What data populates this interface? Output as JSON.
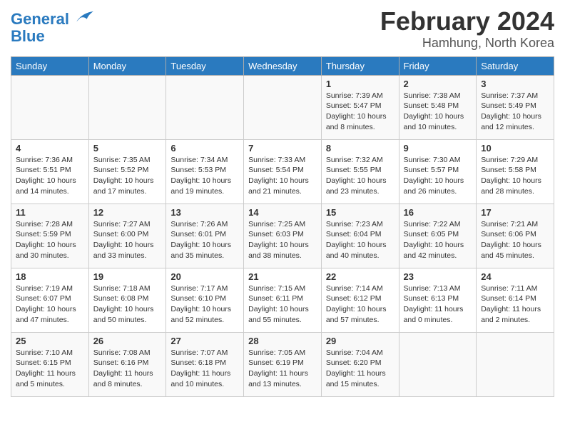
{
  "header": {
    "logo_line1": "General",
    "logo_line2": "Blue",
    "month": "February 2024",
    "location": "Hamhung, North Korea"
  },
  "weekdays": [
    "Sunday",
    "Monday",
    "Tuesday",
    "Wednesday",
    "Thursday",
    "Friday",
    "Saturday"
  ],
  "weeks": [
    [
      {
        "day": "",
        "info": ""
      },
      {
        "day": "",
        "info": ""
      },
      {
        "day": "",
        "info": ""
      },
      {
        "day": "",
        "info": ""
      },
      {
        "day": "1",
        "info": "Sunrise: 7:39 AM\nSunset: 5:47 PM\nDaylight: 10 hours\nand 8 minutes."
      },
      {
        "day": "2",
        "info": "Sunrise: 7:38 AM\nSunset: 5:48 PM\nDaylight: 10 hours\nand 10 minutes."
      },
      {
        "day": "3",
        "info": "Sunrise: 7:37 AM\nSunset: 5:49 PM\nDaylight: 10 hours\nand 12 minutes."
      }
    ],
    [
      {
        "day": "4",
        "info": "Sunrise: 7:36 AM\nSunset: 5:51 PM\nDaylight: 10 hours\nand 14 minutes."
      },
      {
        "day": "5",
        "info": "Sunrise: 7:35 AM\nSunset: 5:52 PM\nDaylight: 10 hours\nand 17 minutes."
      },
      {
        "day": "6",
        "info": "Sunrise: 7:34 AM\nSunset: 5:53 PM\nDaylight: 10 hours\nand 19 minutes."
      },
      {
        "day": "7",
        "info": "Sunrise: 7:33 AM\nSunset: 5:54 PM\nDaylight: 10 hours\nand 21 minutes."
      },
      {
        "day": "8",
        "info": "Sunrise: 7:32 AM\nSunset: 5:55 PM\nDaylight: 10 hours\nand 23 minutes."
      },
      {
        "day": "9",
        "info": "Sunrise: 7:30 AM\nSunset: 5:57 PM\nDaylight: 10 hours\nand 26 minutes."
      },
      {
        "day": "10",
        "info": "Sunrise: 7:29 AM\nSunset: 5:58 PM\nDaylight: 10 hours\nand 28 minutes."
      }
    ],
    [
      {
        "day": "11",
        "info": "Sunrise: 7:28 AM\nSunset: 5:59 PM\nDaylight: 10 hours\nand 30 minutes."
      },
      {
        "day": "12",
        "info": "Sunrise: 7:27 AM\nSunset: 6:00 PM\nDaylight: 10 hours\nand 33 minutes."
      },
      {
        "day": "13",
        "info": "Sunrise: 7:26 AM\nSunset: 6:01 PM\nDaylight: 10 hours\nand 35 minutes."
      },
      {
        "day": "14",
        "info": "Sunrise: 7:25 AM\nSunset: 6:03 PM\nDaylight: 10 hours\nand 38 minutes."
      },
      {
        "day": "15",
        "info": "Sunrise: 7:23 AM\nSunset: 6:04 PM\nDaylight: 10 hours\nand 40 minutes."
      },
      {
        "day": "16",
        "info": "Sunrise: 7:22 AM\nSunset: 6:05 PM\nDaylight: 10 hours\nand 42 minutes."
      },
      {
        "day": "17",
        "info": "Sunrise: 7:21 AM\nSunset: 6:06 PM\nDaylight: 10 hours\nand 45 minutes."
      }
    ],
    [
      {
        "day": "18",
        "info": "Sunrise: 7:19 AM\nSunset: 6:07 PM\nDaylight: 10 hours\nand 47 minutes."
      },
      {
        "day": "19",
        "info": "Sunrise: 7:18 AM\nSunset: 6:08 PM\nDaylight: 10 hours\nand 50 minutes."
      },
      {
        "day": "20",
        "info": "Sunrise: 7:17 AM\nSunset: 6:10 PM\nDaylight: 10 hours\nand 52 minutes."
      },
      {
        "day": "21",
        "info": "Sunrise: 7:15 AM\nSunset: 6:11 PM\nDaylight: 10 hours\nand 55 minutes."
      },
      {
        "day": "22",
        "info": "Sunrise: 7:14 AM\nSunset: 6:12 PM\nDaylight: 10 hours\nand 57 minutes."
      },
      {
        "day": "23",
        "info": "Sunrise: 7:13 AM\nSunset: 6:13 PM\nDaylight: 11 hours\nand 0 minutes."
      },
      {
        "day": "24",
        "info": "Sunrise: 7:11 AM\nSunset: 6:14 PM\nDaylight: 11 hours\nand 2 minutes."
      }
    ],
    [
      {
        "day": "25",
        "info": "Sunrise: 7:10 AM\nSunset: 6:15 PM\nDaylight: 11 hours\nand 5 minutes."
      },
      {
        "day": "26",
        "info": "Sunrise: 7:08 AM\nSunset: 6:16 PM\nDaylight: 11 hours\nand 8 minutes."
      },
      {
        "day": "27",
        "info": "Sunrise: 7:07 AM\nSunset: 6:18 PM\nDaylight: 11 hours\nand 10 minutes."
      },
      {
        "day": "28",
        "info": "Sunrise: 7:05 AM\nSunset: 6:19 PM\nDaylight: 11 hours\nand 13 minutes."
      },
      {
        "day": "29",
        "info": "Sunrise: 7:04 AM\nSunset: 6:20 PM\nDaylight: 11 hours\nand 15 minutes."
      },
      {
        "day": "",
        "info": ""
      },
      {
        "day": "",
        "info": ""
      }
    ]
  ]
}
